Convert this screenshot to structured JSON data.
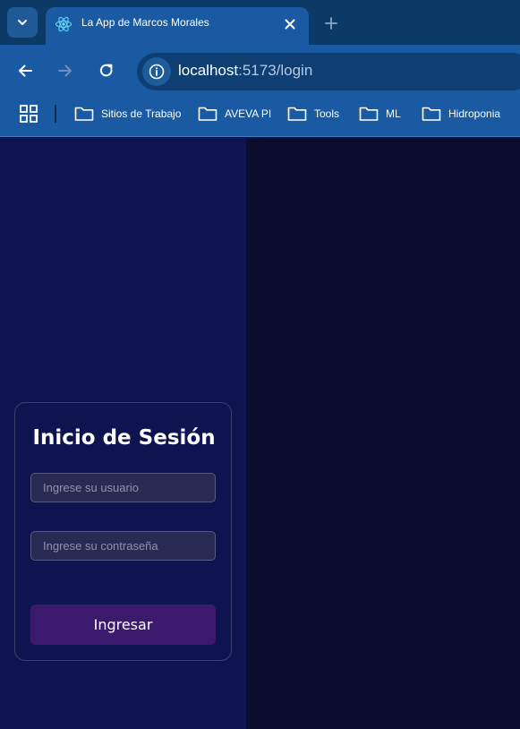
{
  "browser": {
    "tab": {
      "title": "La App de Marcos Morales"
    },
    "address_bar": {
      "host": "localhost",
      "path": ":5173/login"
    },
    "bookmarks": [
      {
        "label": "Sitios de Trabajo"
      },
      {
        "label": "AVEVA PI"
      },
      {
        "label": "Tools"
      },
      {
        "label": "ML"
      },
      {
        "label": "Hidroponia"
      }
    ]
  },
  "login": {
    "title": "Inicio de Sesión",
    "username_placeholder": "Ingrese su usuario",
    "password_placeholder": "Ingrese su contraseña",
    "submit_label": "Ingresar"
  },
  "colors": {
    "left_panel": "#0d1450",
    "right_panel": "#0a0d2b",
    "submit_button": "#3b1a6e",
    "browser_chrome": "#1a5aa2"
  },
  "icons": [
    "chevron-down-icon",
    "react-logo-icon",
    "close-icon",
    "plus-icon",
    "back-arrow-icon",
    "forward-arrow-icon",
    "reload-icon",
    "info-icon",
    "apps-grid-icon",
    "folder-icon"
  ]
}
